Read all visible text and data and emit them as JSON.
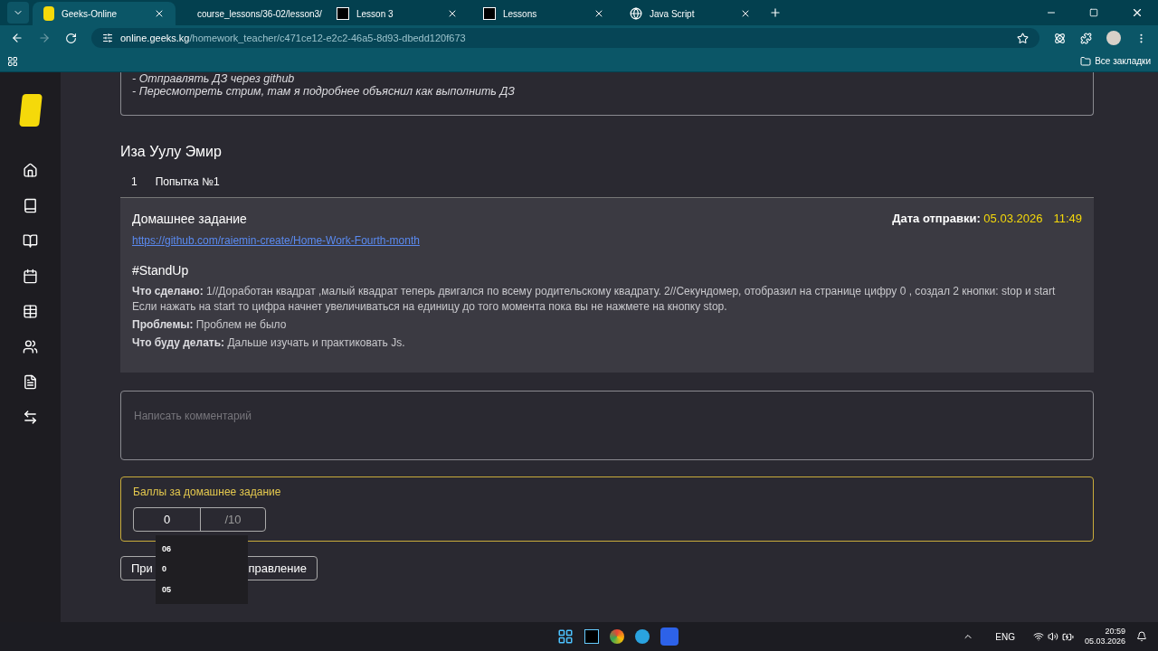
{
  "browser": {
    "tabs": [
      {
        "title": "Geeks-Online",
        "selected": true
      },
      {
        "title": "course_lessons/36-02/lesson3/",
        "selected": false
      },
      {
        "title": "Lesson 3",
        "selected": false
      },
      {
        "title": "Lessons",
        "selected": false
      },
      {
        "title": "Java Script",
        "selected": false
      }
    ],
    "url_host": "online.geeks.kg",
    "url_path": "/homework_teacher/c471ce12-e2c2-46a5-8d93-dbedd120f673",
    "bookmarks_label": "Все закладки"
  },
  "sidebar": {
    "items": [
      {
        "kind": "home",
        "selected": false
      },
      {
        "kind": "book",
        "selected": false
      },
      {
        "kind": "open-book",
        "selected": false
      },
      {
        "kind": "calendar",
        "selected": false
      },
      {
        "kind": "table",
        "selected": false
      },
      {
        "kind": "users",
        "selected": false
      },
      {
        "kind": "notes",
        "selected": false
      },
      {
        "kind": "swap",
        "selected": false
      }
    ]
  },
  "task_notes": [
    "- Отправлять ДЗ через github",
    "- Пересмотреть стрим, там я подробнее объяснил как выполнить ДЗ"
  ],
  "student": "Иза Уулу Эмир",
  "attempts": [
    {
      "number": "1",
      "label": "Попытка №1",
      "selected": true
    }
  ],
  "submission": {
    "title": "Домашнее задание",
    "date_label": "Дата отправки:",
    "date": "05.03.2026",
    "time": "11:49",
    "link": "https://github.com/raiemin-create/Home-Work-Fourth-month",
    "heading": "#StandUp",
    "lines": [
      {
        "label": "Что сделано:",
        "text": "1//Доработан квадрат ,малый квадрат теперь двигался по всему родительскому квадрату. 2//Секундомер, отобразил на странице цифру 0 , создал 2 кнопки: stop и start Если нажать на start то цифра начнет увеличиваться на единицу до того момента пока вы не нажмете на кнопку stop."
      },
      {
        "label": "Проблемы:",
        "text": "Проблем не было"
      },
      {
        "label": "Что буду делать:",
        "text": "Дальше изучать и практиковать Js."
      }
    ]
  },
  "comment": {
    "placeholder": "Написать комментарий"
  },
  "score": {
    "title": "Баллы за домашнее задание",
    "value": "0",
    "max": "/10",
    "suggestions": [
      "06",
      "0",
      "05"
    ]
  },
  "action_button": {
    "visible_start": "При",
    "visible_end": "правление"
  },
  "taskbar": {
    "language": "ENG",
    "time": "20:59",
    "date": "05.03.2026"
  }
}
